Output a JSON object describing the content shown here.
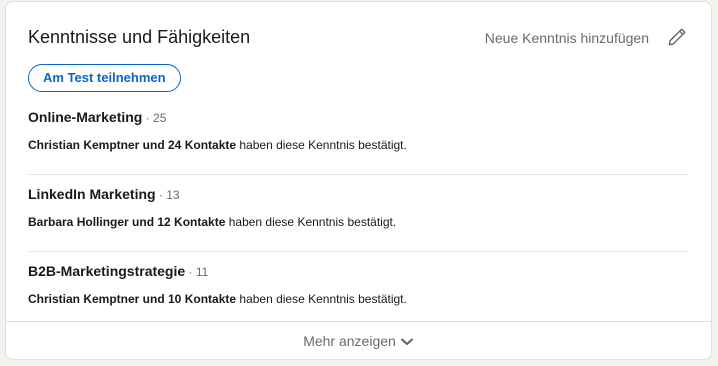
{
  "section": {
    "title": "Kenntnisse und Fähigkeiten",
    "add_label": "Neue Kenntnis hinzufügen",
    "test_button_label": "Am Test teilnehmen",
    "edit_icon": "pencil-icon"
  },
  "skills": [
    {
      "name": "Online-Marketing",
      "count": "25",
      "endorsers": "Christian Kemptner und 24 Kontakte",
      "endorse_text": "haben diese Kenntnis bestätigt."
    },
    {
      "name": "LinkedIn Marketing",
      "count": "13",
      "endorsers": "Barbara Hollinger und 12 Kontakte",
      "endorse_text": "haben diese Kenntnis bestätigt."
    },
    {
      "name": "B2B-Marketingstrategie",
      "count": "11",
      "endorsers": "Christian Kemptner und 10 Kontakte",
      "endorse_text": "haben diese Kenntnis bestätigt."
    }
  ],
  "footer": {
    "more_label": "Mehr anzeigen",
    "chevron_icon": "chevron-down-icon"
  },
  "colors": {
    "accent": "#0a66c2",
    "card_background": "#ffffff",
    "page_background": "#f3f2ef"
  }
}
